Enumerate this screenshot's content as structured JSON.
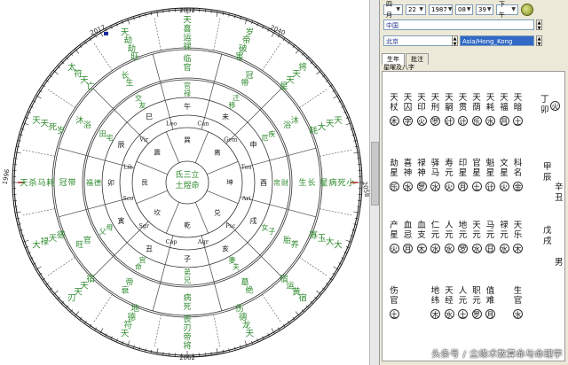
{
  "chart": {
    "years": {
      "top": "2032",
      "top_left": "2017",
      "top_right": "2040",
      "left": "1996",
      "right": "2058",
      "bottom": "2062"
    },
    "outer_cells": [
      [
        "天",
        "喜",
        "运",
        "禄"
      ],
      [
        "岁",
        "帝",
        "破",
        "害"
      ],
      [
        "将",
        "天",
        "天",
        "星"
      ],
      [
        "天",
        "天",
        "大",
        "耗"
      ],
      [
        "小",
        "死",
        "病",
        "星"
      ],
      [
        "大",
        "大",
        "玉",
        "寡"
      ],
      [
        "宿",
        "黄",
        "运",
        "宿"
      ],
      [
        "天",
        "龙",
        "德",
        "伤"
      ],
      [
        "将",
        "帝",
        "刃",
        "丧"
      ],
      [
        "天",
        "符",
        "德",
        "地"
      ],
      [
        "刃",
        "天",
        "天",
        "宿"
      ],
      [
        "大",
        "禄",
        "天",
        "德"
      ],
      [
        "天",
        "杀",
        "马",
        "耗"
      ],
      [
        "天",
        "天",
        "死",
        "岁"
      ],
      [
        "太",
        "符",
        "天",
        "亡"
      ],
      [
        "天",
        "劫",
        "劫",
        "旺"
      ]
    ],
    "middle_cells": [
      [
        "临",
        "官"
      ],
      [
        "冠",
        "带"
      ],
      [
        "沐",
        "浴"
      ],
      [
        "长",
        "生"
      ],
      [
        "养",
        "胎"
      ],
      [
        "绝",
        "墓"
      ],
      [
        "死",
        "病"
      ],
      [
        "衰",
        "帝"
      ],
      [
        "旺",
        "官"
      ],
      [
        "冠",
        "带"
      ],
      [
        "沐",
        "浴"
      ],
      [
        "长",
        "生"
      ]
    ],
    "inner_cells": [
      [
        "官",
        "禄"
      ],
      [
        "迁",
        "移"
      ],
      [
        "疾",
        "厄"
      ],
      [
        "财",
        "帛"
      ],
      [
        "子",
        "女"
      ],
      [
        "夫",
        "妻"
      ],
      [
        "兄",
        "弟"
      ],
      [
        "命",
        "宫"
      ],
      [
        "父",
        "母"
      ],
      [
        "福",
        "德"
      ],
      [
        "田",
        "宅"
      ],
      [
        "交",
        "友"
      ]
    ],
    "branches": [
      "午",
      "未",
      "申",
      "酉",
      "戌",
      "亥",
      "子",
      "丑",
      "寅",
      "卯",
      "辰",
      "巳"
    ],
    "center": {
      "line1": "氐三立",
      "line2": "土煜命"
    },
    "constellations": [
      "Leo",
      "Can",
      "Gem",
      "Tau",
      "Ari",
      "Psc",
      "Aqr",
      "Cap",
      "Sgr",
      "Sco",
      "Lib",
      "Vir"
    ],
    "palace_labels": [
      "巽",
      "离",
      "坤",
      "兑",
      "乾",
      "坎",
      "艮",
      "震"
    ]
  },
  "panel": {
    "month": "四月",
    "day": "22",
    "year": "1987",
    "hour": "08",
    "minute": "39",
    "ampm": "下午",
    "country": "中国",
    "city": "北京",
    "timezone": "Asia/Hong_Kong",
    "tabs": [
      "生年",
      "批注"
    ],
    "inner_label": "星曜及八字",
    "star_rows": {
      "row1_top": [
        [
          "天",
          "杖"
        ],
        [
          "天",
          "囚"
        ],
        [
          "天",
          "印"
        ],
        [
          "天",
          "刑"
        ],
        [
          "天",
          "嗣"
        ],
        [
          "天",
          "贯"
        ],
        [
          "天",
          "荫"
        ],
        [
          "天",
          "耗"
        ],
        [
          "天",
          "福"
        ],
        [
          "天",
          "暗"
        ]
      ],
      "row1_bot": [
        "木",
        "字",
        "火",
        "罗",
        "计",
        "计",
        "乐",
        "水",
        "月",
        "土"
      ],
      "row2_top": [
        [
          "劫",
          "星"
        ],
        [
          "喜",
          "神"
        ],
        [
          "禄",
          "神"
        ],
        [
          "驿",
          "马"
        ],
        [
          "寿",
          "元"
        ],
        [
          "印",
          "星"
        ],
        [
          "官",
          "星"
        ],
        [
          "魁",
          "星"
        ],
        [
          "文",
          "星"
        ],
        [
          "科",
          "名"
        ]
      ],
      "row2_bot": [
        "乐",
        "水",
        "罗",
        "水",
        "火",
        "月",
        "土",
        "计",
        "火",
        "金"
      ],
      "row3_top": [
        [
          "产",
          "星"
        ],
        [
          "血",
          "忌"
        ],
        [
          "血",
          "支"
        ],
        [
          "仁",
          "元"
        ],
        [
          "人",
          "元"
        ],
        [
          "地",
          "元"
        ],
        [
          "天",
          "元"
        ],
        [
          "马",
          "元"
        ],
        [
          "禄",
          "元"
        ],
        [
          "天",
          "乐"
        ]
      ],
      "row3_bot": [
        "火",
        "月",
        "木",
        "水",
        "水",
        "罗",
        "水",
        "日",
        "水",
        "木"
      ],
      "row4_top": [
        [
          "伤",
          "官"
        ],
        [
          "",
          ""
        ],
        [
          "",
          ""
        ],
        [
          "地",
          "纬"
        ],
        [
          "天",
          "经"
        ],
        [
          "人",
          "元"
        ],
        [
          "职",
          "元"
        ],
        [
          "值",
          "难"
        ],
        [
          "",
          ""
        ],
        [
          "生",
          "官"
        ]
      ],
      "row4_bot": [
        "土",
        "",
        "",
        "木",
        "水",
        "土",
        "罗",
        "月",
        "",
        "水"
      ]
    },
    "side_info": {
      "line1": "丁卯",
      "circ1": "火",
      "line2a": "甲辰",
      "line2b": "辛丑",
      "line3a": "戊戌",
      "line3b": "男"
    }
  },
  "watermark": "头条号 / 尘缘术数算命与命理学",
  "colors": {
    "green": "#2e8a2e",
    "dark": "#1a1a1a",
    "purple": "#a020c0",
    "red": "#c01818",
    "blue": "#1c2c9c"
  }
}
